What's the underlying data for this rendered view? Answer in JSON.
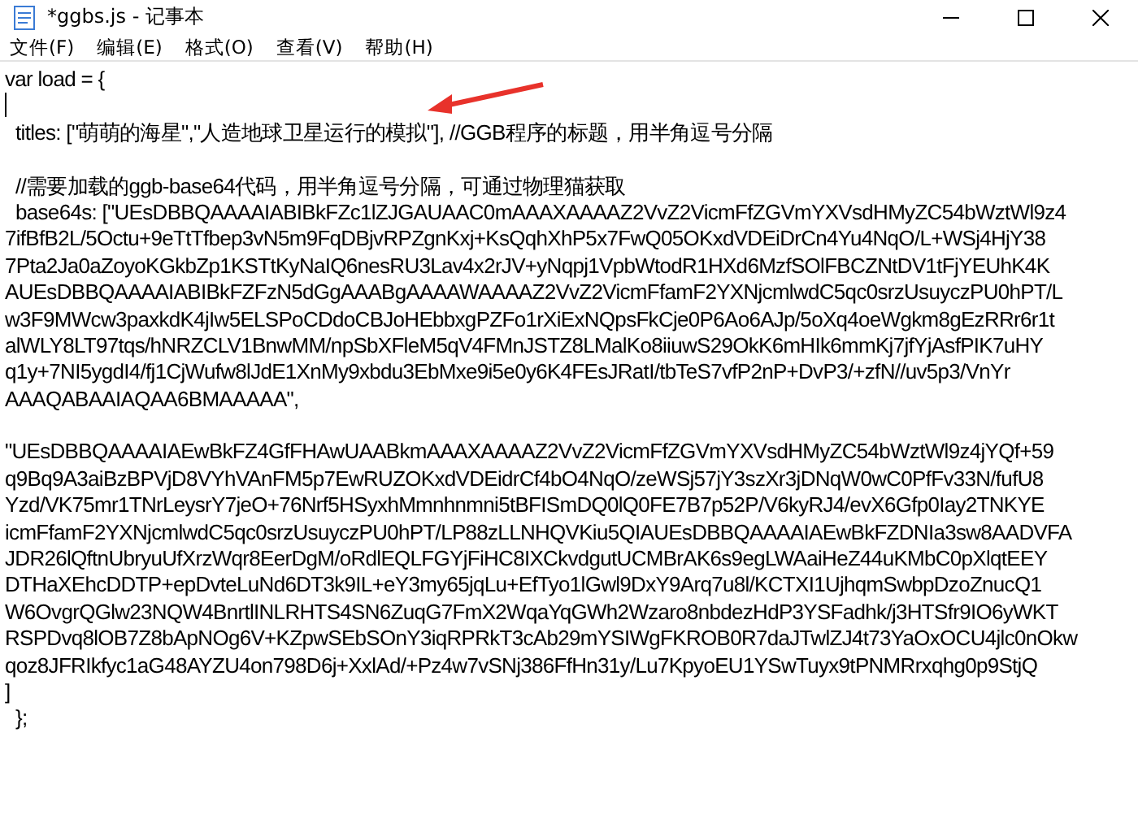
{
  "window": {
    "title": "*ggbs.js - 记事本"
  },
  "menu": [
    "文件(F)",
    "编辑(E)",
    "格式(O)",
    "查看(V)",
    "帮助(H)"
  ],
  "editor": {
    "lines": [
      {
        "kind": "text",
        "text": "var load = {"
      },
      {
        "kind": "cursor"
      },
      {
        "kind": "text",
        "text": "  titles: [\"萌萌的海星\",\"人造地球卫星运行的模拟\"], //GGB程序的标题，用半角逗号分隔"
      },
      {
        "kind": "blank"
      },
      {
        "kind": "text",
        "text": "  //需要加载的ggb-base64代码，用半角逗号分隔，可通过物理猫获取"
      },
      {
        "kind": "text",
        "text": "  base64s: [\"UEsDBBQAAAAIABIBkFZc1lZJGAUAAC0mAAAXAAAAZ2VvZ2VicmFfZGVmYXVsdHMyZC54bWztWl9z4"
      },
      {
        "kind": "text",
        "text": "7ifBfB2L/5Octu+9eTtTfbep3vN5m9FqDBjvRPZgnKxj+KsQqhXhP5x7FwQ05OKxdVDEiDrCn4Yu4NqO/L+WSj4HjY38"
      },
      {
        "kind": "text",
        "text": "7Pta2Ja0aZoyoKGkbZp1KSTtKyNaIQ6nesRU3Lav4x2rJV+yNqpj1VpbWtodR1HXd6MzfSOlFBCZNtDV1tFjYEUhK4K"
      },
      {
        "kind": "text",
        "text": "AUEsDBBQAAAAIABIBkFZFzN5dGgAAABgAAAAWAAAAZ2VvZ2VicmFfamF2YXNjcmlwdC5qc0srzUsuyczPU0hPT/L"
      },
      {
        "kind": "text",
        "text": "w3F9MWcw3paxkdK4jIw5ELSPoCDdoCBJoHEbbxgPZFo1rXiExNQpsFkCje0P6Ao6AJp/5oXq4oeWgkm8gEzRRr6r1t"
      },
      {
        "kind": "text",
        "text": "alWLY8LT97tqs/hNRZCLV1BnwMM/npSbXFleM5qV4FMnJSTZ8LMalKo8iiuwS29OkK6mHIk6mmKj7jfYjAsfPIK7uHY"
      },
      {
        "kind": "text",
        "text": "q1y+7NI5ygdI4/fj1CjWufw8lJdE1XnMy9xbdu3EbMxe9i5e0y6K4FEsJRatI/tbTeS7vfP2nP+DvP3/+zfN//uv5p3/VnYr"
      },
      {
        "kind": "text",
        "text": "AAAQABAAIAQAA6BMAAAAA\","
      },
      {
        "kind": "blank"
      },
      {
        "kind": "text",
        "text": "\"UEsDBBQAAAAIAEwBkFZ4GfFHAwUAABkmAAAXAAAAZ2VvZ2VicmFfZGVmYXVsdHMyZC54bWztWl9z4jYQf+59"
      },
      {
        "kind": "text",
        "text": "q9Bq9A3aiBzBPVjD8VYhVAnFM5p7EwRUZOKxdVDEidrCf4bO4NqO/zeWSj57jY3szXr3jDNqW0wC0PfFv33N/fufU8"
      },
      {
        "kind": "text",
        "text": "Yzd/VK75mr1TNrLeysrY7jeO+76Nrf5HSyxhMmnhnmni5tBFISmDQ0lQ0FE7B7p52P/V6kyRJ4/evX6Gfp0Iay2TNKYE"
      },
      {
        "kind": "text",
        "text": "icmFfamF2YXNjcmlwdC5qc0srzUsuyczPU0hPT/LP88zLLNHQVKiu5QIAUEsDBBQAAAAIAEwBkFZDNIa3sw8AADVFA"
      },
      {
        "kind": "text",
        "text": "JDR26lQftnUbryuUfXrzWqr8EerDgM/oRdlEQLFGYjFiHC8IXCkvdgutUCMBrAK6s9egLWAaiHeZ44uKMbC0pXlqtEEY"
      },
      {
        "kind": "text",
        "text": "DTHaXEhcDDTP+epDvteLuNd6DT3k9IL+eY3my65jqLu+EfTyo1lGwl9DxY9Arq7u8l/KCTXI1UjhqmSwbpDzoZnucQ1"
      },
      {
        "kind": "text",
        "text": "W6OvgrQGlw23NQW4BnrtlINLRHTS4SN6ZuqG7FmX2WqaYqGWh2Wzaro8nbdezHdP3YSFadhk/j3HTSfr9IO6yWKT"
      },
      {
        "kind": "text",
        "text": "RSPDvq8lOB7Z8bApNOg6V+KZpwSEbSOnY3iqRPRkT3cAb29mYSIWgFKROB0R7daJTwlZJ4t73YaOxOCU4jlc0nOkw"
      },
      {
        "kind": "text",
        "text": "qoz8JFRIkfyc1aG48AYZU4on798D6j+XxlAd/+Pz4w7vSNj386FfHn31y/Lu7KpyoEU1YSwTuyx9tPNMRrxqhg0p9StjQ"
      },
      {
        "kind": "text",
        "text": "]"
      },
      {
        "kind": "text",
        "text": "  };"
      }
    ]
  }
}
